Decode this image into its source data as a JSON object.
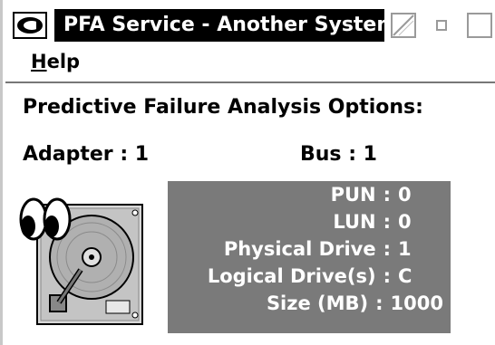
{
  "window": {
    "title": "PFA Service - Another System",
    "menu": {
      "help_mnemonic": "H",
      "help_rest": "elp"
    }
  },
  "content": {
    "heading": "Predictive Failure Analysis Options:",
    "adapter_label": "Adapter",
    "adapter_value": "1",
    "bus_label": "Bus",
    "bus_value": "1"
  },
  "drive_info": [
    {
      "label": "PUN",
      "value": "0"
    },
    {
      "label": "LUN",
      "value": "0"
    },
    {
      "label": "Physical Drive",
      "value": "1"
    },
    {
      "label": "Logical Drive(s)",
      "value": "C"
    },
    {
      "label": "Size (MB)",
      "value": "1000"
    }
  ],
  "colors": {
    "title_bg": "#000000",
    "panel_bg": "#7a7a7a"
  },
  "icons": [
    "system-menu-icon",
    "hide-icon",
    "minimize-icon",
    "maximize-icon",
    "pfa-disk-eyes-icon"
  ]
}
